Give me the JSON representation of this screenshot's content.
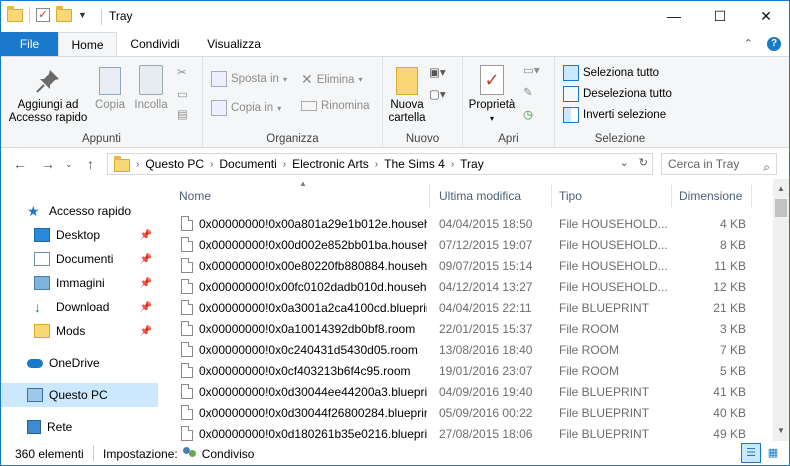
{
  "window": {
    "title": "Tray",
    "minimize": "—",
    "maximize": "☐",
    "close": "✕"
  },
  "ribbon_tabs": [
    "File",
    "Home",
    "Condividi",
    "Visualizza"
  ],
  "ribbon": {
    "clipboard": {
      "pin_label": "Aggiungi ad Accesso rapido",
      "copy_label": "Copia",
      "paste_label": "Incolla",
      "group_label": "Appunti"
    },
    "organize": {
      "move_to": "Sposta in",
      "copy_to": "Copia in",
      "delete": "Elimina",
      "rename": "Rinomina",
      "group_label": "Organizza"
    },
    "new": {
      "new_folder": "Nuova cartella",
      "group_label": "Nuovo"
    },
    "open": {
      "properties": "Proprietà",
      "group_label": "Apri"
    },
    "select": {
      "select_all": "Seleziona tutto",
      "select_none": "Deseleziona tutto",
      "invert": "Inverti selezione",
      "group_label": "Selezione"
    }
  },
  "address": {
    "breadcrumbs": [
      "Questo PC",
      "Documenti",
      "Electronic Arts",
      "The Sims 4",
      "Tray"
    ],
    "search_placeholder": "Cerca in Tray"
  },
  "nav_pane": {
    "quick_access": "Accesso rapido",
    "items": [
      "Desktop",
      "Documenti",
      "Immagini",
      "Download",
      "Mods"
    ],
    "onedrive": "OneDrive",
    "this_pc": "Questo PC",
    "network": "Rete"
  },
  "columns": {
    "name": "Nome",
    "modified": "Ultima modifica",
    "type": "Tipo",
    "size": "Dimensione"
  },
  "files": [
    {
      "name": "0x00000000!0x00a801a29e1b012e.househ...",
      "date": "04/04/2015 18:50",
      "type": "File HOUSEHOLD...",
      "size": "4 KB"
    },
    {
      "name": "0x00000000!0x00d002e852bb01ba.househ...",
      "date": "07/12/2015 19:07",
      "type": "File HOUSEHOLD...",
      "size": "8 KB"
    },
    {
      "name": "0x00000000!0x00e80220fb880884.househo...",
      "date": "09/07/2015 15:14",
      "type": "File HOUSEHOLD...",
      "size": "11 KB"
    },
    {
      "name": "0x00000000!0x00fc0102dadb010d.househ...",
      "date": "04/12/2014 13:27",
      "type": "File HOUSEHOLD...",
      "size": "12 KB"
    },
    {
      "name": "0x00000000!0x0a3001a2ca4100cd.blueprint",
      "date": "04/04/2015 22:11",
      "type": "File BLUEPRINT",
      "size": "21 KB"
    },
    {
      "name": "0x00000000!0x0a10014392db0bf8.room",
      "date": "22/01/2015 15:37",
      "type": "File ROOM",
      "size": "3 KB"
    },
    {
      "name": "0x00000000!0x0c240431d5430d05.room",
      "date": "13/08/2016 18:40",
      "type": "File ROOM",
      "size": "7 KB"
    },
    {
      "name": "0x00000000!0x0cf403213b6f4c95.room",
      "date": "19/01/2016 23:07",
      "type": "File ROOM",
      "size": "5 KB"
    },
    {
      "name": "0x00000000!0x0d30044ee44200a3.blueprint",
      "date": "04/09/2016 19:40",
      "type": "File BLUEPRINT",
      "size": "41 KB"
    },
    {
      "name": "0x00000000!0x0d30044f26800284.blueprint",
      "date": "05/09/2016 00:22",
      "type": "File BLUEPRINT",
      "size": "40 KB"
    },
    {
      "name": "0x00000000!0x0d180261b35e0216.blueprint",
      "date": "27/08/2015 18:06",
      "type": "File BLUEPRINT",
      "size": "49 KB"
    }
  ],
  "status": {
    "count": "360 elementi",
    "setting_label": "Impostazione:",
    "setting_value": "Condiviso"
  },
  "colors": {
    "accent": "#1979ca",
    "selected_bg": "#cce8ff",
    "ribbon_bg": "#f5f6f7"
  }
}
